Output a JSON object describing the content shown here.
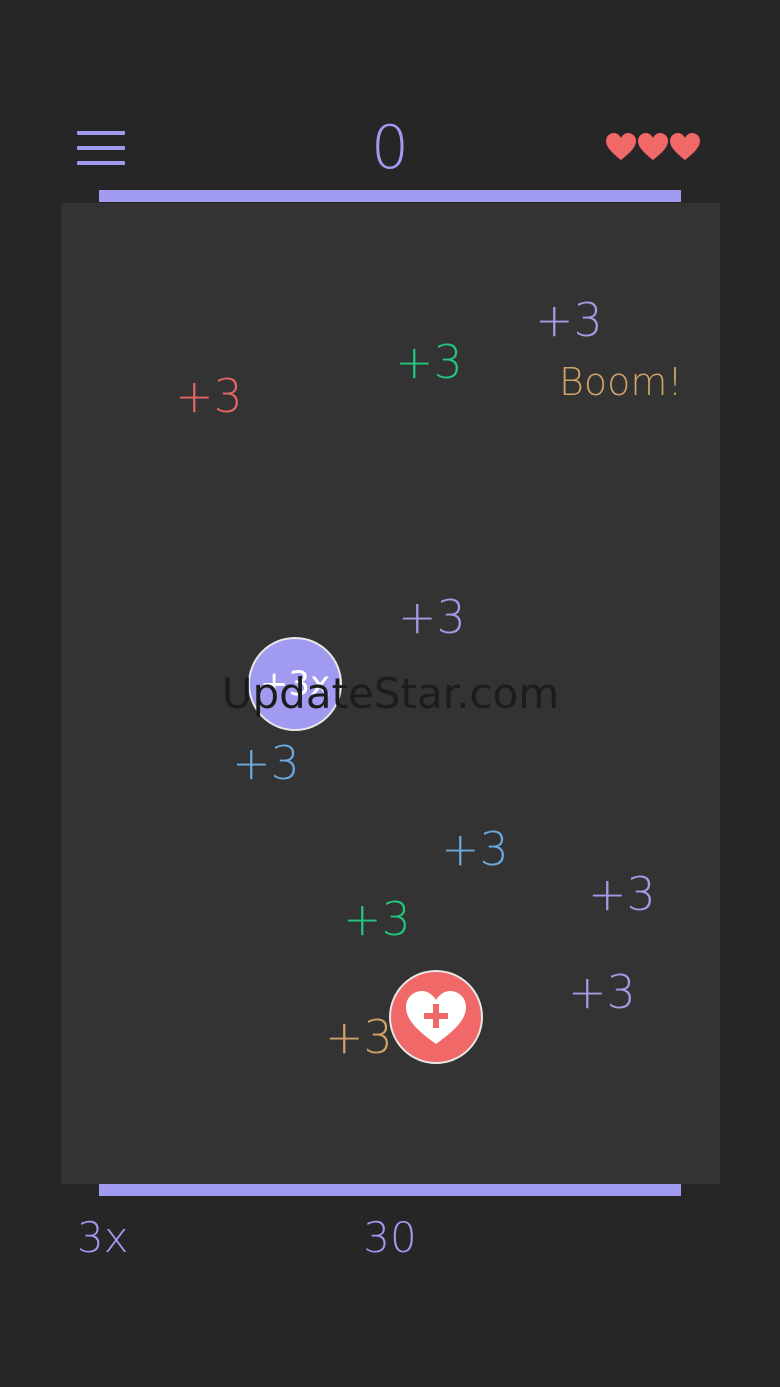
{
  "header": {
    "score": "0",
    "lives": 3,
    "icons": {
      "menu": "hamburger-menu-icon",
      "life": "heart-icon"
    }
  },
  "colors": {
    "accent": "#a09af0",
    "red": "#e06666",
    "green": "#22c47e",
    "purple": "#a59ae6",
    "blue": "#6aa8de",
    "orange": "#cfa267",
    "heart": "#f06868"
  },
  "popups": [
    {
      "text": "+3",
      "color": "#e06666"
    },
    {
      "text": "+3",
      "color": "#22c47e"
    },
    {
      "text": "+3",
      "color": "#a59ae6"
    },
    {
      "text": "+3",
      "color": "#a59ae6"
    },
    {
      "text": "+3",
      "color": "#6aa8de"
    },
    {
      "text": "+3",
      "color": "#6aa8de"
    },
    {
      "text": "+3",
      "color": "#a59ae6"
    },
    {
      "text": "+3",
      "color": "#22c47e"
    },
    {
      "text": "+3",
      "color": "#a59ae6"
    },
    {
      "text": "+3",
      "color": "#cfa267"
    }
  ],
  "boom_text": "Boom!",
  "bubbles": {
    "multiplier_label": "+3x",
    "heart_icon": "heart-plus-icon"
  },
  "watermark": "UpdateStar.com",
  "footer": {
    "multiplier": "3x",
    "timer": "30"
  }
}
